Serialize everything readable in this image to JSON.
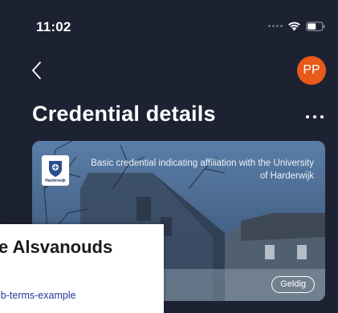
{
  "status_bar": {
    "time": "11:02"
  },
  "nav": {
    "back_icon": "chevron-left-icon",
    "avatar_initials": "PP",
    "avatar_color": "#e8591a"
  },
  "header": {
    "title": "Credential details",
    "more_icon": "ellipsis-icon"
  },
  "card": {
    "logo_text": "Harderwijk",
    "description": "Basic credential indicating affiliation with the University of Harderwijk",
    "status": "Geldig"
  },
  "overlay": {
    "title": "e Alsvanouds",
    "link": "ib-terms-example"
  },
  "colors": {
    "background": "#1d2233",
    "accent": "#e8591a",
    "link": "#1a3a9a"
  }
}
